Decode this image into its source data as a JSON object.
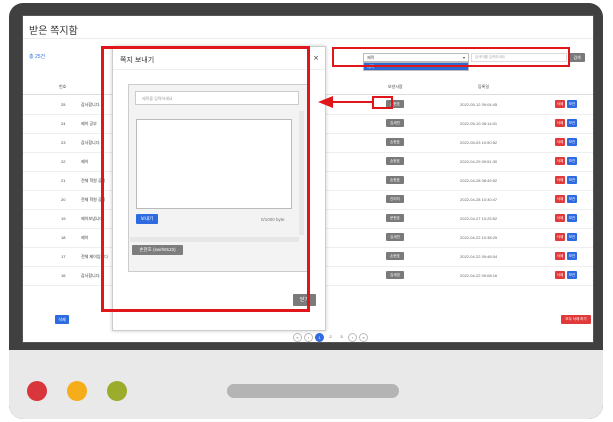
{
  "page": {
    "title": "받은 쪽지함",
    "total": "총 25건"
  },
  "search": {
    "selected": "제목",
    "options": [
      "제목"
    ],
    "placeholder": "검색어를 입력하세요",
    "button": "검색"
  },
  "table": {
    "headers": [
      "번호",
      "",
      "보낸사람",
      "등록일",
      ""
    ],
    "rows": [
      {
        "num": "25",
        "subject": "감사합니다.",
        "sender": "손현호",
        "date": "2022-05-12 09:04:45"
      },
      {
        "num": "24",
        "subject": "제이 공부",
        "sender": "김세연",
        "date": "2022-05-10 08:14:01"
      },
      {
        "num": "23",
        "subject": "감사합니다.",
        "sender": "손현호",
        "date": "2022-05-03 10:50:52"
      },
      {
        "num": "22",
        "subject": "제이",
        "sender": "손현호",
        "date": "2022-04-29 09:51:30"
      },
      {
        "num": "21",
        "subject": "전체 학원 공지",
        "sender": "손현호",
        "date": "2022-04-28 08:49:52"
      },
      {
        "num": "20",
        "subject": "전체 학원 공지",
        "sender": "관리자",
        "date": "2022-04-28 10:30:47"
      },
      {
        "num": "19",
        "subject": "제이보냅니다",
        "sender": "문현호",
        "date": "2022-04-27 10:25:52"
      },
      {
        "num": "18",
        "subject": "제이",
        "sender": "김세연",
        "date": "2022-04-22 10:38:25"
      },
      {
        "num": "17",
        "subject": "전체 제이입니다",
        "sender": "손현호",
        "date": "2022-04-22 09:48:04"
      },
      {
        "num": "16",
        "subject": "감사합니다.",
        "sender": "김세영",
        "date": "2022-04-22 09:08:16"
      }
    ],
    "delete_label": "삭제",
    "keep_label": "보관"
  },
  "footer": {
    "delete_button": "삭제",
    "delete_all_button": "모두 삭제 하기",
    "pages": [
      "«",
      "‹",
      "1",
      "2",
      "3",
      "›",
      "»"
    ],
    "current_page": "1"
  },
  "modal": {
    "title": "쪽지 보내기",
    "close_icon": "×",
    "subject_placeholder": "제목을 입력하세요",
    "send_button": "보내기",
    "char_count": "0/1000 byte",
    "recipient": "손현호 (swrh9122)",
    "close_button": "닫기"
  },
  "colors": {
    "highlight": "#e0161b",
    "primary": "#2e6be0",
    "danger": "#e23a3a",
    "neutral": "#7a7a7a"
  }
}
